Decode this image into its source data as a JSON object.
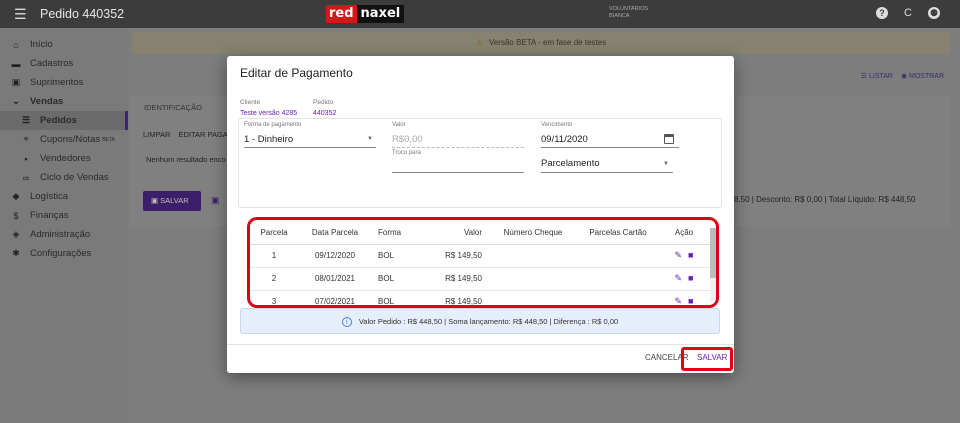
{
  "topbar": {
    "title": "Pedido 440352",
    "logo_red": "red",
    "logo_black": "naxel",
    "user_line1": "VOLUNTARIOS",
    "user_line2": "BIANCA",
    "icons": [
      "help-icon",
      "refresh-icon",
      "account-icon"
    ],
    "icon_glyphs": {
      "help": "?",
      "refresh": "C",
      "account": "⚉"
    }
  },
  "sidebar": {
    "items": [
      {
        "label": "Início",
        "icon": "home-icon",
        "glyph": "⌂"
      },
      {
        "label": "Cadastros",
        "icon": "folder-icon",
        "glyph": "▬"
      },
      {
        "label": "Suprimentos",
        "icon": "box-icon",
        "glyph": "▣"
      },
      {
        "label": "Vendas",
        "icon": "chevron-down-icon",
        "glyph": "⌄"
      },
      {
        "label": "Pedidos",
        "icon": "list-icon",
        "glyph": "☰"
      },
      {
        "label": "Cupons/Notas",
        "beta": "BETA",
        "icon": "coupon-icon",
        "glyph": "⌖"
      },
      {
        "label": "Vendedores",
        "icon": "badge-icon",
        "glyph": "▪"
      },
      {
        "label": "Ciclo de Vendas",
        "icon": "cycle-icon",
        "glyph": "∞"
      },
      {
        "label": "Logística",
        "icon": "logistics-icon",
        "glyph": "◆"
      },
      {
        "label": "Finanças",
        "icon": "dollar-icon",
        "glyph": "$"
      },
      {
        "label": "Administração",
        "icon": "shield-icon",
        "glyph": "◈"
      },
      {
        "label": "Configurações",
        "icon": "gear-icon",
        "glyph": "✱"
      }
    ]
  },
  "background": {
    "beta_banner": "Versão BETA - em fase de testes",
    "warning_glyph": "⚠",
    "listar": "LISTAR",
    "mostrar": "MOSTRAR",
    "tab": "IDENTIFICAÇÃO",
    "link_limpar": "LIMPAR",
    "link_editar": "EDITAR PAGA",
    "no_result": "Nenhum resultado enco",
    "save": "SALVAR",
    "totals": "8,50 | Desconto: R$ 0,00 | Total Líquido: R$ 448,50"
  },
  "modal": {
    "title": "Editar de Pagamento",
    "cliente_label": "Cliente",
    "cliente_value": "Teste versão 4285",
    "pedido_label": "Pedido",
    "pedido_value": "440352",
    "forma_label": "Forma de pagamento",
    "forma_value": "1 - Dinheiro",
    "valor_label": "Valor",
    "valor_value": "R$0,00",
    "troco_label": "Troco para",
    "troco_value": "",
    "vencimento_label": "Vencimento",
    "vencimento_value": "09/11/2020",
    "parcelamento_value": "Parcelamento",
    "table": {
      "headers": [
        "Parcela",
        "Data Parcela",
        "Forma",
        "Valor",
        "Número Cheque",
        "Parcelas Cartão",
        "Ação"
      ],
      "rows": [
        {
          "parcela": "1",
          "data": "09/12/2020",
          "forma": "BOL",
          "valor": "R$ 149,50",
          "cheque": "",
          "cartao": ""
        },
        {
          "parcela": "2",
          "data": "08/01/2021",
          "forma": "BOL",
          "valor": "R$ 149,50",
          "cheque": "",
          "cartao": ""
        },
        {
          "parcela": "3",
          "data": "07/02/2021",
          "forma": "BOL",
          "valor": "R$ 149,50",
          "cheque": "",
          "cartao": ""
        }
      ]
    },
    "summary": "Valor Pedido : R$ 448,50 | Soma lançamento: R$ 448,50 | Diferença : R$ 0,00",
    "cancel": "CANCELAR",
    "save": "SALVAR"
  },
  "colors": {
    "accent": "#6a1fb8",
    "highlight": "#e0001a",
    "topbar": "#3c3c3c"
  }
}
